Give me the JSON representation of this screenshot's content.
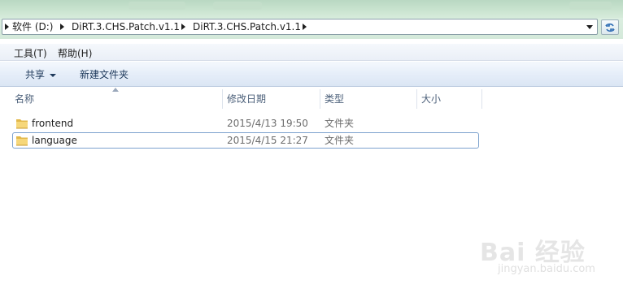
{
  "address": {
    "segments": [
      "软件 (D:)",
      "DiRT.3.CHS.Patch.v1.1",
      "DiRT.3.CHS.Patch.v1.1"
    ]
  },
  "menubar": {
    "tools": "工具(T)",
    "help": "帮助(H)"
  },
  "commandbar": {
    "share": "共享",
    "new_folder": "新建文件夹"
  },
  "columns": {
    "name": "名称",
    "date_modified": "修改日期",
    "type": "类型",
    "size": "大小"
  },
  "files": [
    {
      "name": "frontend",
      "date": "2015/4/13 19:50",
      "type": "文件夹",
      "selected": false
    },
    {
      "name": "language",
      "date": "2015/4/15 21:27",
      "type": "文件夹",
      "selected": true
    }
  ],
  "watermark": {
    "logo": "Bai 经验",
    "url": "jingyan.baidu.com"
  },
  "colors": {
    "titlebar": "#c9e3cf",
    "selection_border": "#7da2ce",
    "folder": "#e8c45a"
  }
}
